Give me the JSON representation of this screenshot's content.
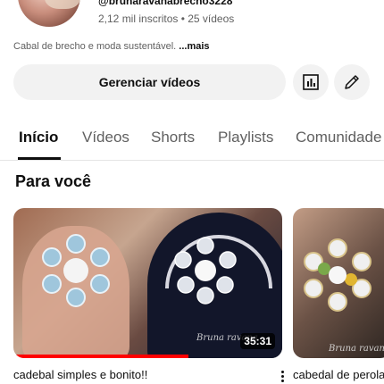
{
  "channel": {
    "handle": "@brunaravanabrecho3228",
    "stats": "2,12 mil inscritos • 25 vídeos",
    "description": "Cabal de brecho e moda sustentável.",
    "more_label": "...mais"
  },
  "actions": {
    "manage_videos_label": "Gerenciar vídeos",
    "analytics_icon": "analytics-icon",
    "edit_icon": "pencil-icon"
  },
  "tabs": [
    {
      "label": "Início",
      "active": true
    },
    {
      "label": "Vídeos",
      "active": false
    },
    {
      "label": "Shorts",
      "active": false
    },
    {
      "label": "Playlists",
      "active": false
    },
    {
      "label": "Comunidade",
      "active": false
    }
  ],
  "section": {
    "title": "Para você"
  },
  "videos": [
    {
      "title": "cadebal simples e bonito!!",
      "duration": "35:31",
      "watermark": "Bruna ravana",
      "watch_progress": 0.65
    },
    {
      "title": "cabedal de perolas",
      "watermark": "Bruna ravan"
    }
  ],
  "colors": {
    "progress": "#ff0000",
    "button_bg": "#f2f2f2",
    "text_primary": "#0f0f0f",
    "text_secondary": "#606060"
  }
}
